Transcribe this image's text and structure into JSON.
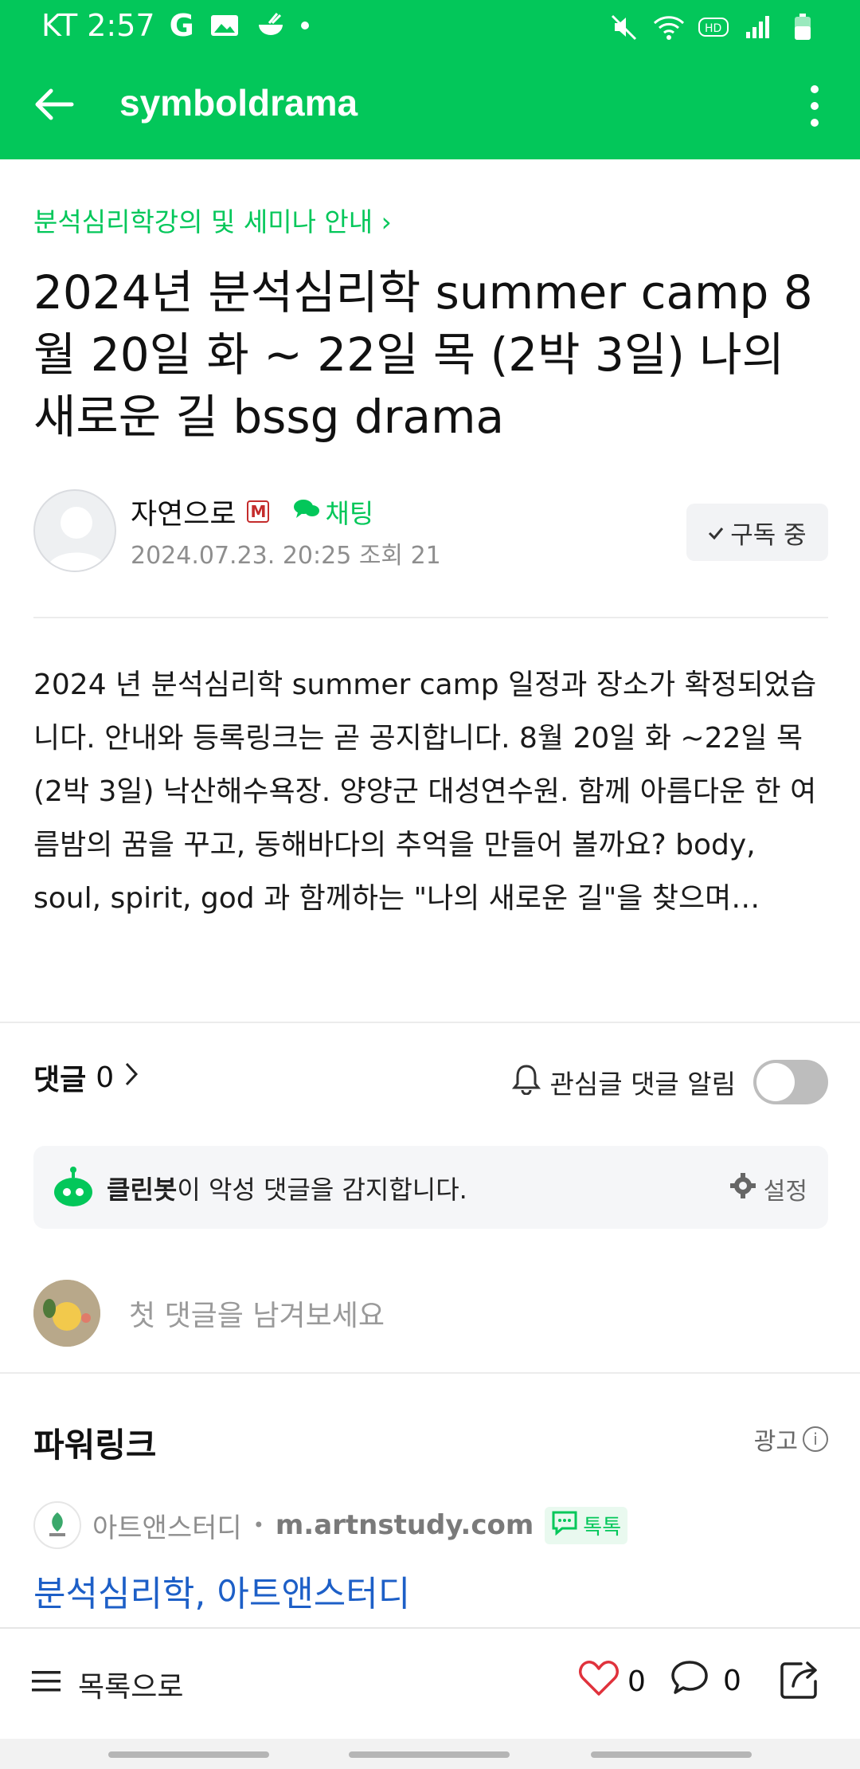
{
  "status_bar": {
    "carrier_time": "KT 2:57",
    "g_icon": "G"
  },
  "app_bar": {
    "title": "symboldrama"
  },
  "post": {
    "breadcrumb": "분석심리학강의 및 세미나 안내 ›",
    "title": "2024년 분석심리학 summer camp 8월 20일 화 ~ 22일 목 (2박 3일) 나의 새로운 길 bssg drama",
    "author": "자연으로",
    "author_badge": "M",
    "chat_label": "채팅",
    "meta": "2024.07.23. 20:25  조회 21",
    "subscribe_label": "구독 중",
    "body": "2024 년 분석심리학 summer camp 일정과 장소가 확정되었습니다. 안내와 등록링크는 곧 공지합니다. 8월 20일 화 ~22일 목 (2박 3일) 낙산해수욕장. 양양군 대성연수원. 함께 아름다운 한 여름밤의 꿈을 꾸고, 동해바다의 추억을 만들어 볼까요?  body, soul, spirit, god 과 함께하는 \"나의 새로운 길\"을 찾으며…"
  },
  "comments": {
    "label": "댓글",
    "count": "0",
    "alert_label": "관심글 댓글 알림",
    "alert_enabled": false,
    "cleanbot_name": "클린봇",
    "cleanbot_text": "이 악성 댓글을 감지합니다.",
    "settings_label": "설정",
    "input_placeholder": "첫 댓글을 남겨보세요"
  },
  "powerlink": {
    "title": "파워링크",
    "ad_label": "광고",
    "advertiser": "아트앤스터디",
    "separator": "•",
    "url": "m.artnstudy.com",
    "talk_label": "톡톡",
    "headline": "분석심리학, 아트앤스터디"
  },
  "bottom_bar": {
    "list_label": "목록으로",
    "like_count": "0",
    "comment_count": "0"
  },
  "colors": {
    "brand_green": "#03c75a",
    "link_blue": "#1d5fc7",
    "like_red": "#e0323c"
  },
  "icons": [
    "back-arrow-icon",
    "more-vert-icon",
    "check-icon",
    "chat-bubble-icon",
    "bell-icon",
    "cleanbot-icon",
    "gear-icon",
    "info-icon",
    "talk-icon",
    "menu-icon",
    "heart-icon",
    "comment-icon",
    "share-icon"
  ]
}
